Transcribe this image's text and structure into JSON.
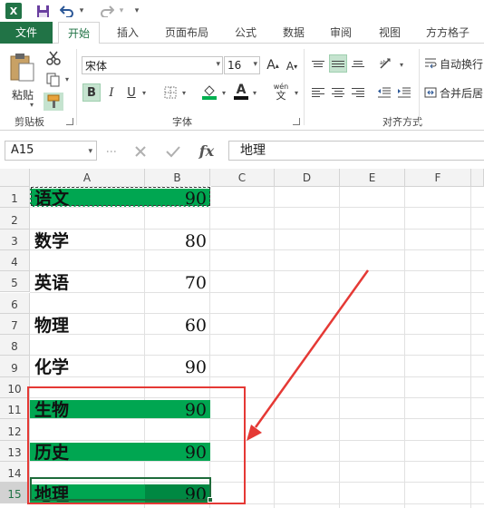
{
  "qat": {
    "excel_glyph": "X",
    "undo_dd": "▾",
    "redo_dd": "▾",
    "customize": "▾"
  },
  "tabs": [
    "文件",
    "开始",
    "插入",
    "页面布局",
    "公式",
    "数据",
    "审阅",
    "视图",
    "方方格子"
  ],
  "active_tab": "开始",
  "ribbon": {
    "clipboard_label": "剪贴板",
    "paste_label": "粘贴",
    "font_group_label": "字体",
    "font_name": "宋体",
    "font_size": "16",
    "bold": "B",
    "italic": "I",
    "underline": "U",
    "phonetic": "wén",
    "alignment_group_label": "对齐方式",
    "wrap_text": "自动换行",
    "merge_center": "合并后居"
  },
  "formula_bar": {
    "name_box": "A15",
    "fx": "fx",
    "content": "地理"
  },
  "columns": [
    "A",
    "B",
    "C",
    "D",
    "E",
    "F"
  ],
  "rows": [
    "1",
    "2",
    "3",
    "4",
    "5",
    "6",
    "7",
    "8",
    "9",
    "10",
    "11",
    "12",
    "13",
    "14",
    "15"
  ],
  "cells": [
    {
      "row": 1,
      "subject": "语文",
      "score": "90",
      "highlight": true
    },
    {
      "row": 3,
      "subject": "数学",
      "score": "80",
      "highlight": false
    },
    {
      "row": 5,
      "subject": "英语",
      "score": "70",
      "highlight": false
    },
    {
      "row": 7,
      "subject": "物理",
      "score": "60",
      "highlight": false
    },
    {
      "row": 9,
      "subject": "化学",
      "score": "90",
      "highlight": false
    },
    {
      "row": 11,
      "subject": "生物",
      "score": "90",
      "highlight": true
    },
    {
      "row": 13,
      "subject": "历史",
      "score": "90",
      "highlight": true
    },
    {
      "row": 15,
      "subject": "地理",
      "score": "90",
      "highlight": true
    }
  ],
  "colors": {
    "excel_green": "#217346",
    "fill_green": "#00a651",
    "annotation_red": "#e53935"
  }
}
